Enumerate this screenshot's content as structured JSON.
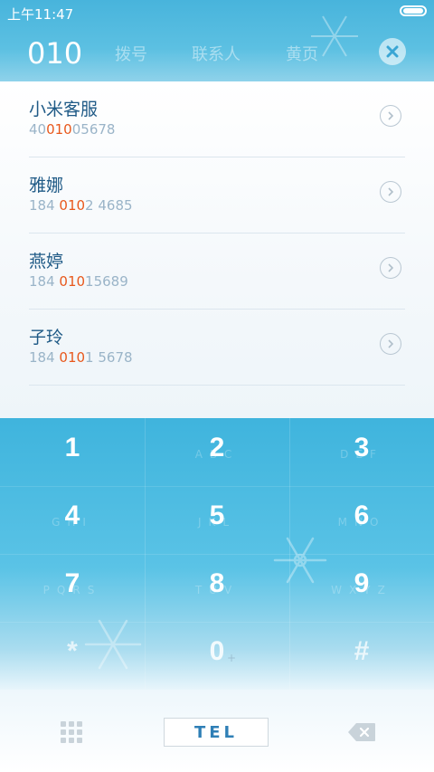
{
  "status_bar": {
    "time": "上午11:47"
  },
  "header": {
    "query": "010",
    "tabs": [
      "拨号",
      "联系人",
      "黄页"
    ]
  },
  "contacts": [
    {
      "name": "小米客服",
      "number_parts": [
        "40",
        "010",
        "05678"
      ]
    },
    {
      "name": "雅娜",
      "number_parts": [
        "184 ",
        "010",
        "2 4685"
      ]
    },
    {
      "name": "燕婷",
      "number_parts": [
        "184 ",
        "010",
        "15689"
      ]
    },
    {
      "name": "子玲",
      "number_parts": [
        "184 ",
        "010",
        "1 5678"
      ]
    }
  ],
  "keypad": {
    "keys": [
      {
        "digit": "1",
        "letters": ""
      },
      {
        "digit": "2",
        "letters": "ABC"
      },
      {
        "digit": "3",
        "letters": "DEF"
      },
      {
        "digit": "4",
        "letters": "GHI"
      },
      {
        "digit": "5",
        "letters": "JKL"
      },
      {
        "digit": "6",
        "letters": "MNO"
      },
      {
        "digit": "7",
        "letters": "PQRS"
      },
      {
        "digit": "8",
        "letters": "TUV"
      },
      {
        "digit": "9",
        "letters": "WXYZ"
      },
      {
        "digit": "*",
        "letters": ""
      },
      {
        "digit": "0",
        "letters": "+"
      },
      {
        "digit": "#",
        "letters": ""
      }
    ]
  },
  "bottom_bar": {
    "call_label": "TEL",
    "left_icon": "dialpad-icon",
    "right_icon": "backspace-icon"
  },
  "colors": {
    "accent": "#48b4dc",
    "match_highlight": "#e8581c",
    "name_text": "#1f5a86",
    "number_text": "#9ab4c8"
  }
}
